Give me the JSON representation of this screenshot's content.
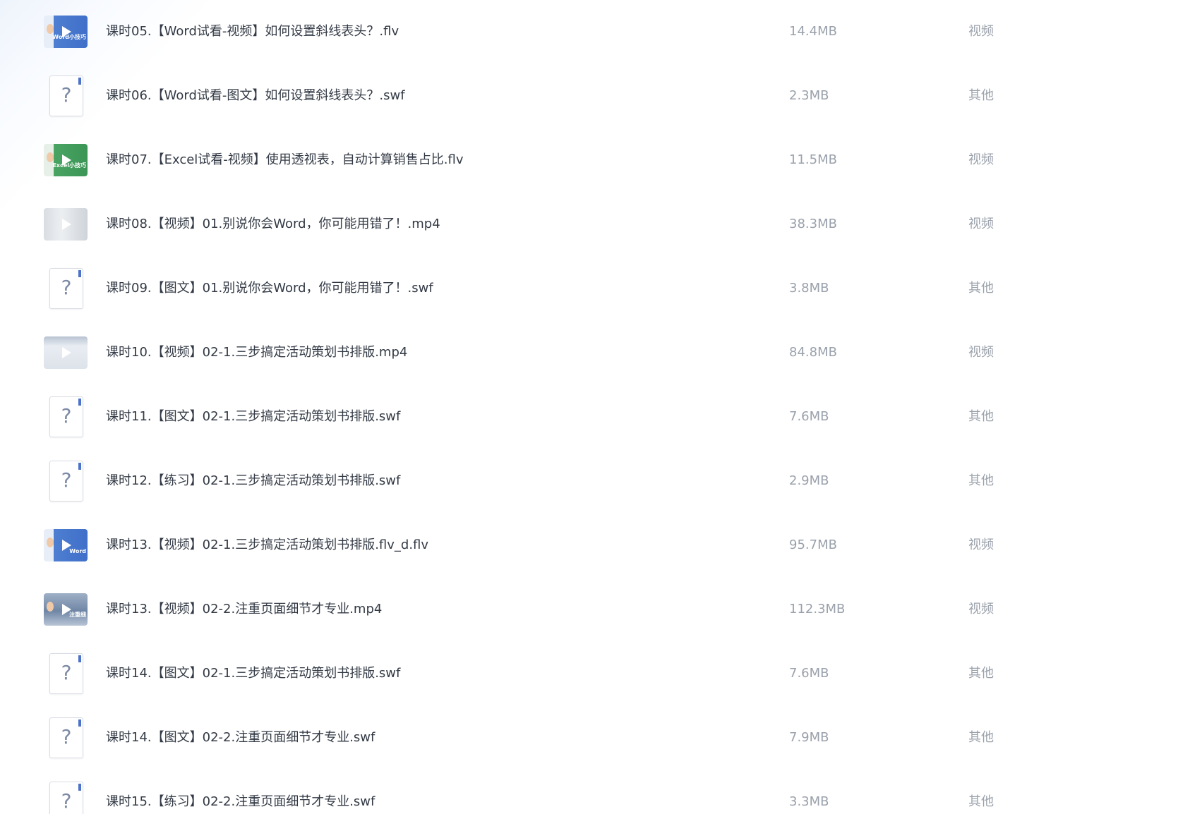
{
  "files": [
    {
      "name": "课时05.【Word试看-视频】如何设置斜线表头？.flv",
      "size": "14.4MB",
      "type": "视频",
      "icon": "video-thumbnail-icon",
      "thumb_caption": "Word小技巧"
    },
    {
      "name": "课时06.【Word试看-图文】如何设置斜线表头？.swf",
      "size": "2.3MB",
      "type": "其他",
      "icon": "unknown-file-icon",
      "thumb_caption": "?"
    },
    {
      "name": "课时07.【Excel试看-视频】使用透视表，自动计算销售占比.flv",
      "size": "11.5MB",
      "type": "视频",
      "icon": "video-thumbnail-icon",
      "thumb_caption": "Excel小技巧"
    },
    {
      "name": "课时08.【视频】01.别说你会Word，你可能用错了！.mp4",
      "size": "38.3MB",
      "type": "视频",
      "icon": "video-thumbnail-icon",
      "thumb_caption": ""
    },
    {
      "name": "课时09.【图文】01.别说你会Word，你可能用错了！.swf",
      "size": "3.8MB",
      "type": "其他",
      "icon": "unknown-file-icon",
      "thumb_caption": "?"
    },
    {
      "name": "课时10.【视频】02-1.三步搞定活动策划书排版.mp4",
      "size": "84.8MB",
      "type": "视频",
      "icon": "video-thumbnail-icon",
      "thumb_caption": ""
    },
    {
      "name": "课时11.【图文】02-1.三步搞定活动策划书排版.swf",
      "size": "7.6MB",
      "type": "其他",
      "icon": "unknown-file-icon",
      "thumb_caption": "?"
    },
    {
      "name": "课时12.【练习】02-1.三步搞定活动策划书排版.swf",
      "size": "2.9MB",
      "type": "其他",
      "icon": "unknown-file-icon",
      "thumb_caption": "?"
    },
    {
      "name": "课时13.【视频】02-1.三步搞定活动策划书排版.flv_d.flv",
      "size": "95.7MB",
      "type": "视频",
      "icon": "video-thumbnail-icon",
      "thumb_caption": "Word"
    },
    {
      "name": "课时13.【视频】02-2.注重页面细节才专业.mp4",
      "size": "112.3MB",
      "type": "视频",
      "icon": "video-thumbnail-icon",
      "thumb_caption": "注重细"
    },
    {
      "name": "课时14.【图文】02-1.三步搞定活动策划书排版.swf",
      "size": "7.6MB",
      "type": "其他",
      "icon": "unknown-file-icon",
      "thumb_caption": "?"
    },
    {
      "name": "课时14.【图文】02-2.注重页面细节才专业.swf",
      "size": "7.9MB",
      "type": "其他",
      "icon": "unknown-file-icon",
      "thumb_caption": "?"
    },
    {
      "name": "课时15.【练习】02-2.注重页面细节才专业.swf",
      "size": "3.3MB",
      "type": "其他",
      "icon": "unknown-file-icon",
      "thumb_caption": "?"
    }
  ]
}
